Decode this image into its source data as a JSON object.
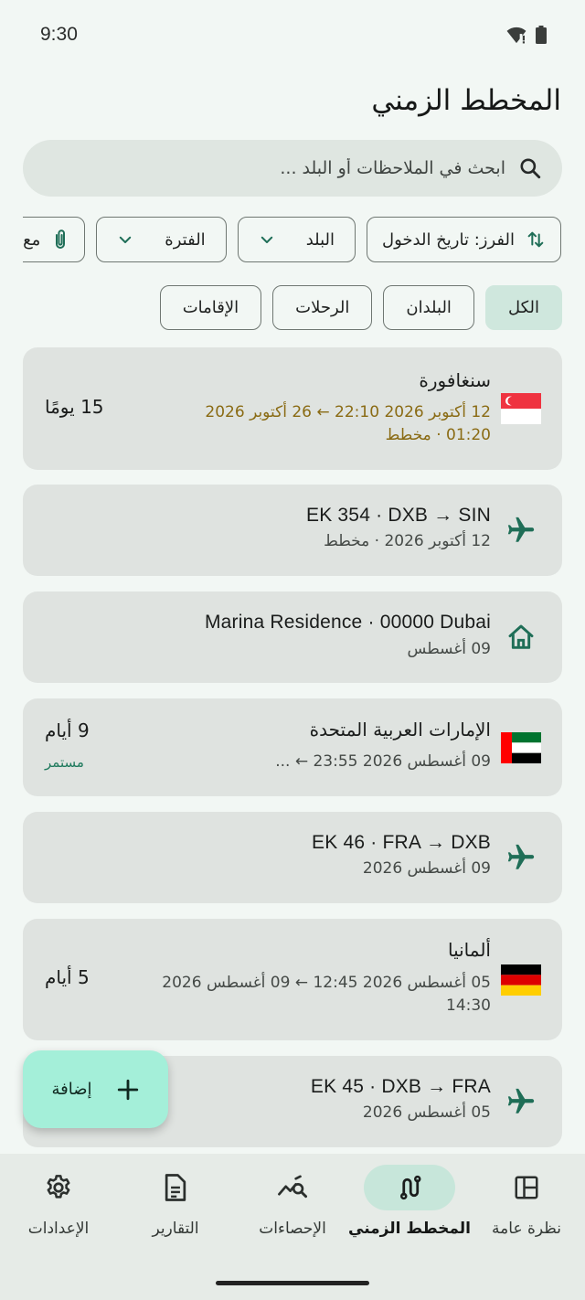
{
  "status_bar": {
    "time": "9:30",
    "icons": [
      "wifi-icon",
      "battery-icon"
    ]
  },
  "page": {
    "title": "المخطط الزمني"
  },
  "search": {
    "placeholder": "ابحث في الملاحظات أو البلد ..."
  },
  "filters": {
    "sort_label": "الفرز: تاريخ الدخول",
    "country_label": "البلد",
    "period_label": "الفترة",
    "attachment_label": "مع مستندات"
  },
  "tabs": [
    {
      "label": "الكل",
      "active": true
    },
    {
      "label": "البلدان",
      "active": false
    },
    {
      "label": "الرحلات",
      "active": false
    },
    {
      "label": "الإقامات",
      "active": false
    }
  ],
  "timeline": [
    {
      "kind": "stay",
      "flag": "sg",
      "title": "سنغافورة",
      "line1": "12 أكتوبر 2026 22:10  ←  26 أكتوبر 2026",
      "line2": "01:20 · مخطط",
      "days": "15 يومًا",
      "status": ""
    },
    {
      "kind": "flight",
      "title": "EK 354 · DXB → SIN",
      "line1": "12 أكتوبر 2026 · مخطط"
    },
    {
      "kind": "accommodation",
      "title": "Marina Residence · 00000 Dubai",
      "line1": "09 أغسطس"
    },
    {
      "kind": "stay",
      "flag": "ae",
      "title": "الإمارات العربية المتحدة",
      "line1": "09 أغسطس 2026 23:55  ←  ...",
      "days": "9 أيام",
      "status": "مستمر"
    },
    {
      "kind": "flight",
      "title": "EK 46 · FRA → DXB",
      "line1": "09 أغسطس 2026"
    },
    {
      "kind": "stay",
      "flag": "de",
      "title": "ألمانيا",
      "line1": "05 أغسطس 2026 12:45  ←  09 أغسطس 2026",
      "line2": "14:30",
      "days": "5 أيام",
      "status": ""
    },
    {
      "kind": "flight",
      "title": "EK 45 · DXB → FRA",
      "line1": "05 أغسطس 2026"
    }
  ],
  "fab": {
    "label": "إضافة"
  },
  "bottom_nav": [
    {
      "label": "نظرة عامة",
      "icon": "dashboard-icon",
      "active": false
    },
    {
      "label": "المخطط الزمني",
      "icon": "route-icon",
      "active": true
    },
    {
      "label": "الإحصاءات",
      "icon": "query-stats-icon",
      "active": false
    },
    {
      "label": "التقارير",
      "icon": "document-icon",
      "active": false
    },
    {
      "label": "الإعدادات",
      "icon": "gear-icon",
      "active": false
    }
  ],
  "colors": {
    "accent": "#1f6e57",
    "background": "#f2f7f4",
    "card": "#dfe3e0",
    "fab": "#a4efd9",
    "planned_text": "#8a6b14"
  }
}
